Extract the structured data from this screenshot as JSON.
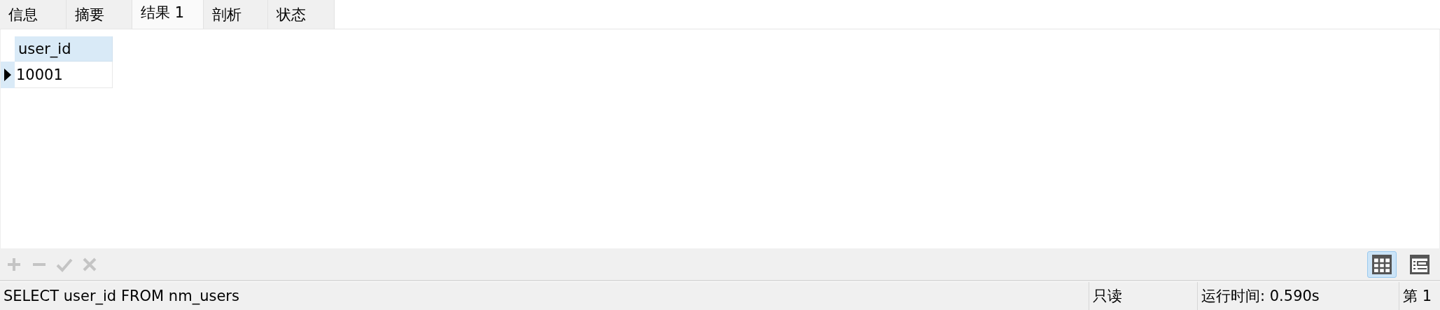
{
  "tabs": [
    {
      "label": "信息",
      "selected": false
    },
    {
      "label": "摘要",
      "selected": false
    },
    {
      "label": "结果 1",
      "selected": true
    },
    {
      "label": "剖析",
      "selected": false
    },
    {
      "label": "状态",
      "selected": false
    }
  ],
  "table": {
    "columns": [
      "user_id"
    ],
    "rows": [
      {
        "cells": [
          "10001"
        ],
        "selected": true
      }
    ]
  },
  "toolbar": {
    "actions": [
      {
        "kind": "add",
        "disabled": true
      },
      {
        "kind": "remove",
        "disabled": true
      },
      {
        "kind": "apply",
        "disabled": true
      },
      {
        "kind": "cancel",
        "disabled": true
      }
    ],
    "views": [
      {
        "kind": "grid",
        "selected": true
      },
      {
        "kind": "form",
        "selected": false
      }
    ]
  },
  "status_bar": {
    "query": "SELECT user_id FROM nm_users",
    "mode": "只读",
    "elapsed": "运行时间: 0.590s",
    "record": "第 1"
  }
}
